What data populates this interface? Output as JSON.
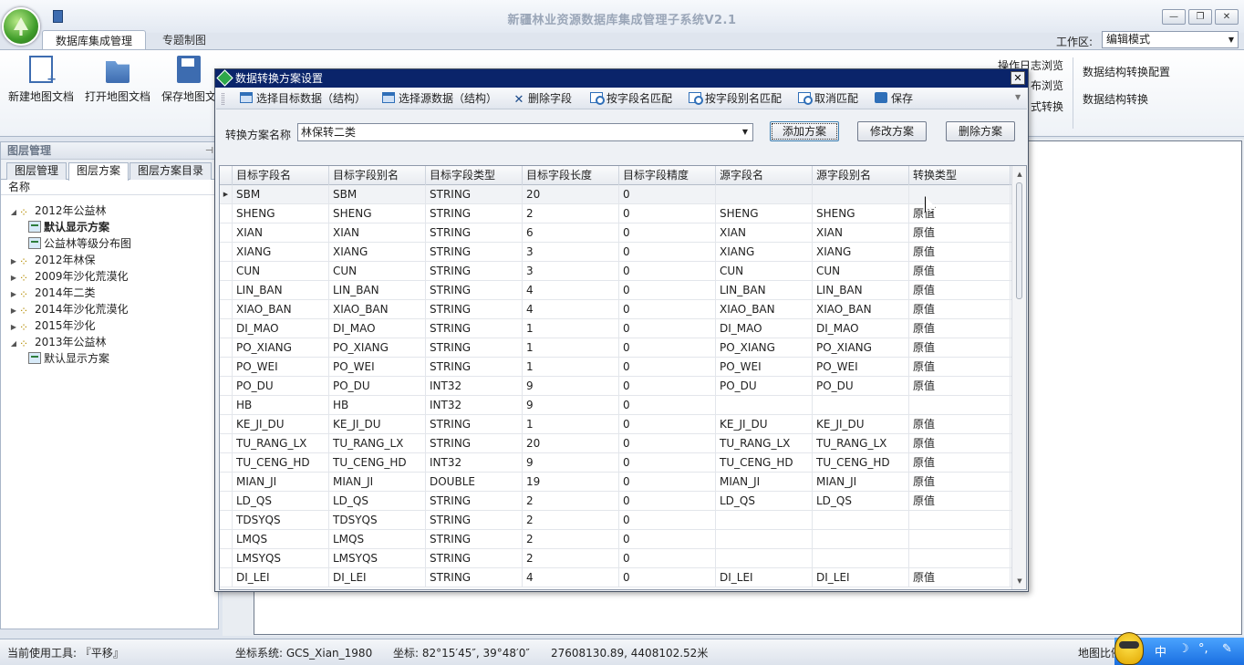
{
  "app": {
    "title": "新疆林业资源数据库集成管理子系统V2.1",
    "window_controls": {
      "minimize": "—",
      "maximize": "❐",
      "close": "✕"
    }
  },
  "ribbon": {
    "tabs": [
      {
        "label": "数据库集成管理",
        "active": true
      },
      {
        "label": "专题制图",
        "active": false
      }
    ],
    "workspace_label": "工作区:",
    "workspace_value": "编辑模式",
    "buttons": [
      {
        "label": "新建地图文档",
        "icon": "new-doc-icon"
      },
      {
        "label": "打开地图文档",
        "icon": "open-folder-icon"
      },
      {
        "label": "保存地图文",
        "icon": "save-disk-icon"
      }
    ],
    "small_items": {
      "log": "操作日志浏览",
      "publish": "布浏览",
      "format": "式转换",
      "struct_config": "数据结构转换配置",
      "struct_convert": "数据结构转换"
    }
  },
  "layer_panel": {
    "title": "图层管理",
    "tabs": [
      {
        "label": "图层管理",
        "active": false
      },
      {
        "label": "图层方案",
        "active": true
      },
      {
        "label": "图层方案目录",
        "active": false
      }
    ],
    "column": "名称",
    "tree": [
      {
        "label": "2012年公益林",
        "level": 0,
        "expanded": true,
        "type": "group"
      },
      {
        "label": "默认显示方案",
        "level": 1,
        "type": "layer",
        "bold": true
      },
      {
        "label": "公益林等级分布图",
        "level": 1,
        "type": "layer"
      },
      {
        "label": "2012年林保",
        "level": 0,
        "expanded": false,
        "type": "group"
      },
      {
        "label": "2009年沙化荒漠化",
        "level": 0,
        "expanded": false,
        "type": "group"
      },
      {
        "label": "2014年二类",
        "level": 0,
        "expanded": false,
        "type": "group"
      },
      {
        "label": "2014年沙化荒漠化",
        "level": 0,
        "expanded": false,
        "type": "group"
      },
      {
        "label": "2015年沙化",
        "level": 0,
        "expanded": false,
        "type": "group"
      },
      {
        "label": "2013年公益林",
        "level": 0,
        "expanded": true,
        "type": "group"
      },
      {
        "label": "默认显示方案",
        "level": 1,
        "type": "layer"
      }
    ]
  },
  "dialog": {
    "title": "数据转换方案设置",
    "close": "✕",
    "toolbar": [
      {
        "label": "选择目标数据（结构）",
        "icon": "table-icon"
      },
      {
        "label": "选择源数据（结构）",
        "icon": "table-icon"
      },
      {
        "label": "删除字段",
        "icon": "delete-x-icon"
      },
      {
        "label": "按字段名匹配",
        "icon": "match-field-icon"
      },
      {
        "label": "按字段别名匹配",
        "icon": "match-alias-icon"
      },
      {
        "label": "取消匹配",
        "icon": "cancel-match-icon"
      },
      {
        "label": "保存",
        "icon": "save-icon"
      }
    ],
    "form": {
      "scheme_label": "转换方案名称",
      "scheme_value": "林保转二类",
      "add_label": "添加方案",
      "edit_label": "修改方案",
      "delete_label": "删除方案"
    },
    "grid": {
      "columns": [
        "目标字段名",
        "目标字段别名",
        "目标字段类型",
        "目标字段长度",
        "目标字段精度",
        "源字段名",
        "源字段别名",
        "转换类型"
      ],
      "rows": [
        [
          "SBM",
          "SBM",
          "STRING",
          "20",
          "0",
          "",
          "",
          ""
        ],
        [
          "SHENG",
          "SHENG",
          "STRING",
          "2",
          "0",
          "SHENG",
          "SHENG",
          "原值"
        ],
        [
          "XIAN",
          "XIAN",
          "STRING",
          "6",
          "0",
          "XIAN",
          "XIAN",
          "原值"
        ],
        [
          "XIANG",
          "XIANG",
          "STRING",
          "3",
          "0",
          "XIANG",
          "XIANG",
          "原值"
        ],
        [
          "CUN",
          "CUN",
          "STRING",
          "3",
          "0",
          "CUN",
          "CUN",
          "原值"
        ],
        [
          "LIN_BAN",
          "LIN_BAN",
          "STRING",
          "4",
          "0",
          "LIN_BAN",
          "LIN_BAN",
          "原值"
        ],
        [
          "XIAO_BAN",
          "XIAO_BAN",
          "STRING",
          "4",
          "0",
          "XIAO_BAN",
          "XIAO_BAN",
          "原值"
        ],
        [
          "DI_MAO",
          "DI_MAO",
          "STRING",
          "1",
          "0",
          "DI_MAO",
          "DI_MAO",
          "原值"
        ],
        [
          "PO_XIANG",
          "PO_XIANG",
          "STRING",
          "1",
          "0",
          "PO_XIANG",
          "PO_XIANG",
          "原值"
        ],
        [
          "PO_WEI",
          "PO_WEI",
          "STRING",
          "1",
          "0",
          "PO_WEI",
          "PO_WEI",
          "原值"
        ],
        [
          "PO_DU",
          "PO_DU",
          "INT32",
          "9",
          "0",
          "PO_DU",
          "PO_DU",
          "原值"
        ],
        [
          "HB",
          "HB",
          "INT32",
          "9",
          "0",
          "",
          "",
          ""
        ],
        [
          "KE_JI_DU",
          "KE_JI_DU",
          "STRING",
          "1",
          "0",
          "KE_JI_DU",
          "KE_JI_DU",
          "原值"
        ],
        [
          "TU_RANG_LX",
          "TU_RANG_LX",
          "STRING",
          "20",
          "0",
          "TU_RANG_LX",
          "TU_RANG_LX",
          "原值"
        ],
        [
          "TU_CENG_HD",
          "TU_CENG_HD",
          "INT32",
          "9",
          "0",
          "TU_CENG_HD",
          "TU_CENG_HD",
          "原值"
        ],
        [
          "MIAN_JI",
          "MIAN_JI",
          "DOUBLE",
          "19",
          "0",
          "MIAN_JI",
          "MIAN_JI",
          "原值"
        ],
        [
          "LD_QS",
          "LD_QS",
          "STRING",
          "2",
          "0",
          "LD_QS",
          "LD_QS",
          "原值"
        ],
        [
          "TDSYQS",
          "TDSYQS",
          "STRING",
          "2",
          "0",
          "",
          "",
          ""
        ],
        [
          "LMQS",
          "LMQS",
          "STRING",
          "2",
          "0",
          "",
          "",
          ""
        ],
        [
          "LMSYQS",
          "LMSYQS",
          "STRING",
          "2",
          "0",
          "",
          "",
          ""
        ],
        [
          "DI_LEI",
          "DI_LEI",
          "STRING",
          "4",
          "0",
          "DI_LEI",
          "DI_LEI",
          "原值"
        ]
      ]
    }
  },
  "status": {
    "tool": "当前使用工具: 『平移』",
    "cs": "坐标系统: GCS_Xian_1980",
    "coord": "坐标: 82°15′45″, 39°48′0″",
    "xy": "27608130.89, 4408102.52米",
    "scale": "地图比例"
  },
  "ime": {
    "lang": "中",
    "moon": "☽",
    "punct": "°,",
    "tool": "✎"
  }
}
